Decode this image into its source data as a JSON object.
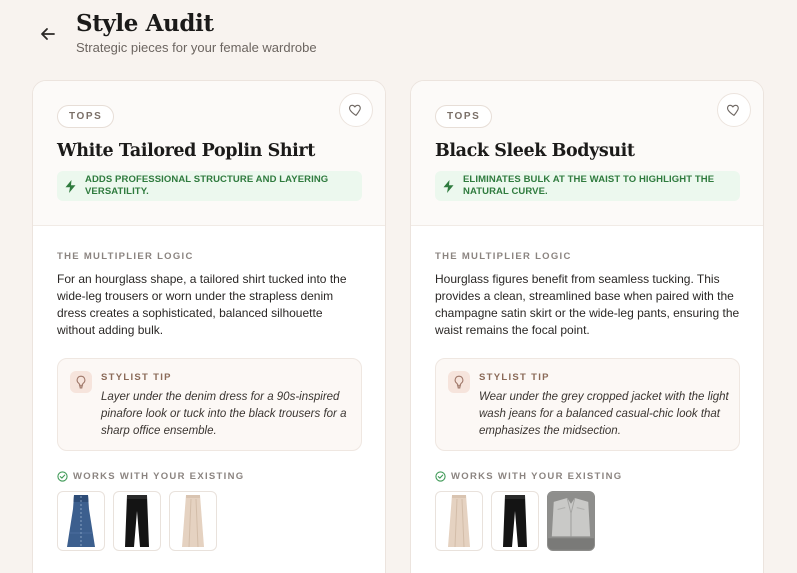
{
  "header": {
    "title": "Style Audit",
    "subtitle": "Strategic pieces for your female wardrobe",
    "back_icon": "arrow-left-icon"
  },
  "cards": [
    {
      "category": "TOPS",
      "title": "White Tailored Poplin Shirt",
      "benefit": "ADDS PROFESSIONAL STRUCTURE AND LAYERING VERSATILITY.",
      "logic_label": "THE MULTIPLIER LOGIC",
      "logic": "For an hourglass shape, a tailored shirt tucked into the wide-leg trousers or worn under the strapless denim dress creates a sophisticated, balanced silhouette without adding bulk.",
      "tip_label": "STYLIST TIP",
      "tip": "Layer under the denim dress for a 90s-inspired pinafore look or tuck into the black trousers for a sharp office ensemble.",
      "works_label": "WORKS WITH YOUR EXISTING",
      "thumbs": [
        "denim-dress",
        "black-trousers",
        "satin-skirt"
      ]
    },
    {
      "category": "TOPS",
      "title": "Black Sleek Bodysuit",
      "benefit": "ELIMINATES BULK AT THE WAIST TO HIGHLIGHT THE NATURAL CURVE.",
      "logic_label": "THE MULTIPLIER LOGIC",
      "logic": "Hourglass figures benefit from seamless tucking. This provides a clean, streamlined base when paired with the champagne satin skirt or the wide-leg pants, ensuring the waist remains the focal point.",
      "tip_label": "STYLIST TIP",
      "tip": "Wear under the grey cropped jacket with the light wash jeans for a balanced casual-chic look that emphasizes the midsection.",
      "works_label": "WORKS WITH YOUR EXISTING",
      "thumbs": [
        "satin-skirt",
        "black-trousers",
        "grey-cropped-jacket"
      ]
    }
  ],
  "colors": {
    "background": "#f8f3ef",
    "benefit_bg": "#ecf8ee",
    "benefit_text": "#2f7b3e",
    "tip_icon_bg": "#f6e4dc"
  }
}
